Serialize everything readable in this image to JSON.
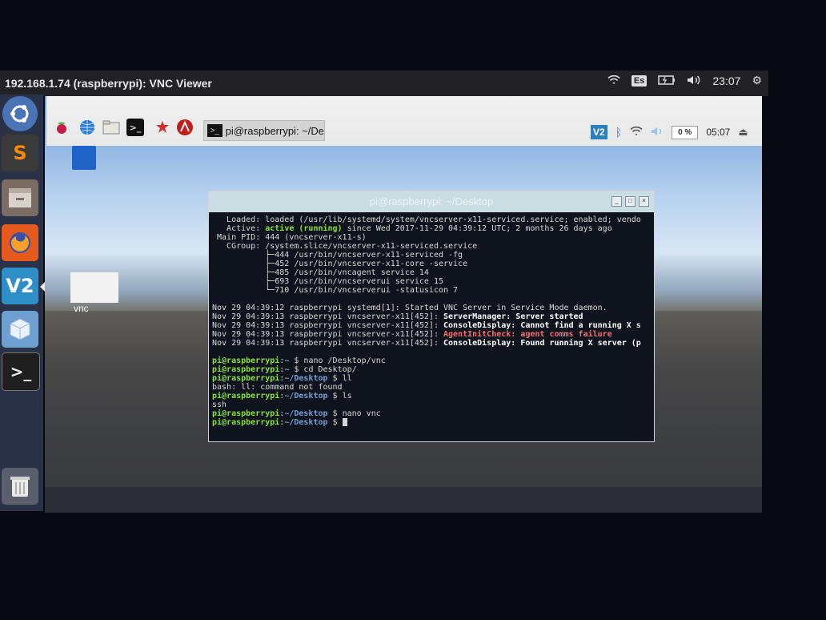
{
  "window": {
    "title": "192.168.1.74 (raspberrypi): VNC Viewer"
  },
  "ubuntu_topbar": {
    "keyboard_layout": "Es",
    "time": "23:07",
    "icons": [
      "wifi-icon",
      "keyboard-layout-indicator",
      "battery-icon",
      "volume-icon",
      "gear-icon"
    ]
  },
  "ubuntu_launcher": {
    "items": [
      "ubuntu-dash",
      "sublime-text",
      "files",
      "firefox",
      "vnc-viewer",
      "box",
      "terminal",
      "trash"
    ],
    "sublime_glyph": "S",
    "vnc_glyph": "V2",
    "terminal_glyph": ">_"
  },
  "pi_taskbar": {
    "task_button": "pi@raspberrypi: ~/De",
    "cpu": "0 %",
    "clock": "05:07"
  },
  "desktop": {
    "vnc_label": "vnc"
  },
  "terminal": {
    "title": "pi@raspberrypi: ~/Desktop",
    "lines": [
      [
        {
          "t": "   Loaded: loaded (/usr/lib/systemd/system/vncserver-x11-serviced.service; enabled; vendo"
        }
      ],
      [
        {
          "t": "   Active: "
        },
        {
          "t": "active (running)",
          "c": "green"
        },
        {
          "t": " since Wed 2017-11-29 04:39:12 UTC; 2 months 26 days ago"
        }
      ],
      [
        {
          "t": " Main PID: 444 (vncserver-x11-s)"
        }
      ],
      [
        {
          "t": "   CGroup: /system.slice/vncserver-x11-serviced.service"
        }
      ],
      [
        {
          "t": "           ├─444 /usr/bin/vncserver-x11-serviced -fg"
        }
      ],
      [
        {
          "t": "           ├─452 /usr/bin/vncserver-x11-core -service"
        }
      ],
      [
        {
          "t": "           ├─485 /usr/bin/vncagent service 14"
        }
      ],
      [
        {
          "t": "           ├─693 /usr/bin/vncserverui service 15"
        }
      ],
      [
        {
          "t": "           └─710 /usr/bin/vncserverui -statusicon 7"
        }
      ],
      [
        {
          "t": ""
        }
      ],
      [
        {
          "t": "Nov 29 04:39:12 raspberrypi systemd[1]: Started VNC Server in Service Mode daemon."
        }
      ],
      [
        {
          "t": "Nov 29 04:39:13 raspberrypi vncserver-x11[452]: "
        },
        {
          "t": "ServerManager: Server started",
          "c": "bold"
        }
      ],
      [
        {
          "t": "Nov 29 04:39:13 raspberrypi vncserver-x11[452]: "
        },
        {
          "t": "ConsoleDisplay: Cannot find a running X s",
          "c": "bold"
        }
      ],
      [
        {
          "t": "Nov 29 04:39:13 raspberrypi vncserver-x11[452]: "
        },
        {
          "t": "AgentInitCheck: agent comms failure",
          "c": "red"
        }
      ],
      [
        {
          "t": "Nov 29 04:39:13 raspberrypi vncserver-x11[452]: "
        },
        {
          "t": "ConsoleDisplay: Found running X server (p",
          "c": "bold"
        }
      ],
      [
        {
          "t": ""
        }
      ],
      [
        {
          "t": "pi@raspberrypi",
          "c": "green"
        },
        {
          "t": ":"
        },
        {
          "t": "~",
          "c": "blue"
        },
        {
          "t": " $ nano /Desktop/vnc"
        }
      ],
      [
        {
          "t": "pi@raspberrypi",
          "c": "green"
        },
        {
          "t": ":"
        },
        {
          "t": "~",
          "c": "blue"
        },
        {
          "t": " $ cd Desktop/"
        }
      ],
      [
        {
          "t": "pi@raspberrypi",
          "c": "green"
        },
        {
          "t": ":"
        },
        {
          "t": "~/Desktop",
          "c": "blue"
        },
        {
          "t": " $ ll"
        }
      ],
      [
        {
          "t": "bash: ll: command not found"
        }
      ],
      [
        {
          "t": "pi@raspberrypi",
          "c": "green"
        },
        {
          "t": ":"
        },
        {
          "t": "~/Desktop",
          "c": "blue"
        },
        {
          "t": " $ ls"
        }
      ],
      [
        {
          "t": "ssh"
        }
      ],
      [
        {
          "t": "pi@raspberrypi",
          "c": "green"
        },
        {
          "t": ":"
        },
        {
          "t": "~/Desktop",
          "c": "blue"
        },
        {
          "t": " $ nano vnc"
        }
      ],
      [
        {
          "t": "pi@raspberrypi",
          "c": "green"
        },
        {
          "t": ":"
        },
        {
          "t": "~/Desktop",
          "c": "blue"
        },
        {
          "t": " $ "
        }
      ]
    ]
  }
}
